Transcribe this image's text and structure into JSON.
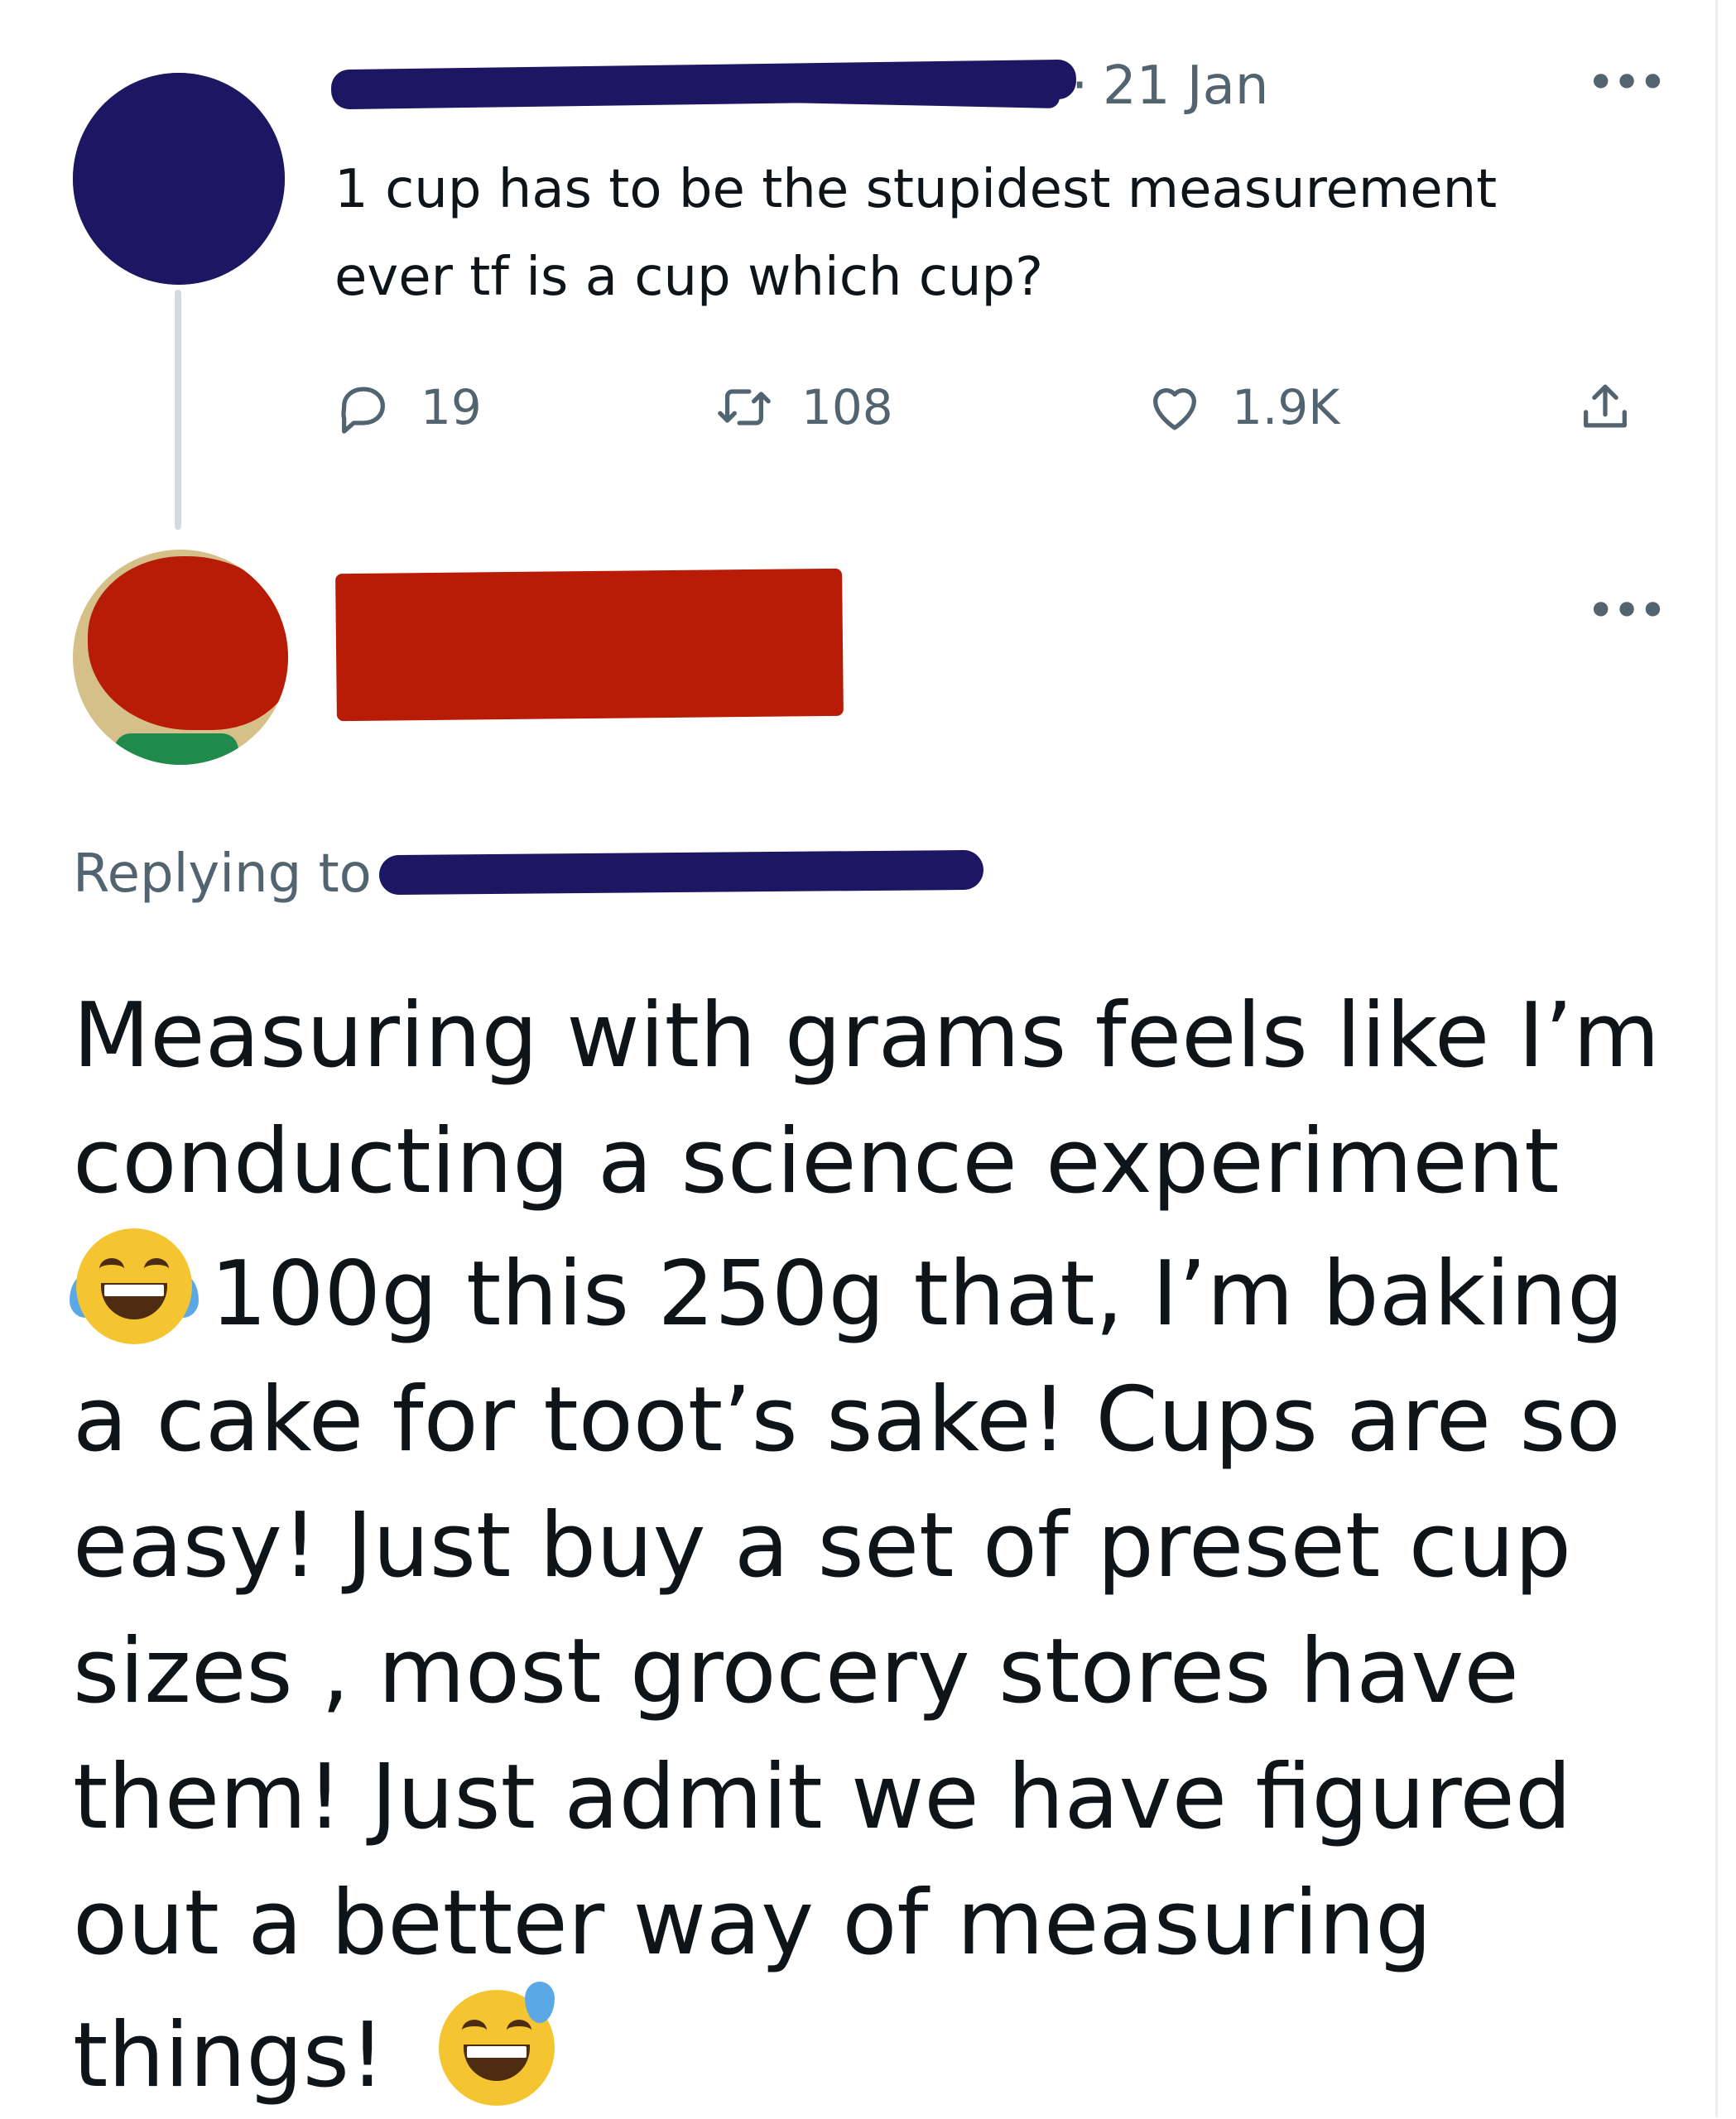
{
  "tweet1": {
    "date": "21 Jan",
    "text": "1 cup has to be the stupidest measurement ever tf is a cup which cup?",
    "stats": {
      "replies": "19",
      "retweets": "108",
      "likes": "1.9K"
    },
    "icons": [
      "reply-icon",
      "retweet-icon",
      "heart-icon",
      "share-icon",
      "more-icon"
    ]
  },
  "tweet2": {
    "replying_to": "Replying to",
    "text_parts": {
      "line_1": "Measuring with grams feels like I’m conducting a science experiment",
      "line_2": "100g this 250g that, I’m baking a cake for toot’s sake! Cups are so easy! Just buy a set of preset cup sizes , most grocery stores have them! Just admit we have figured out a better way of measuring things!"
    },
    "emojis": [
      "tears-of-joy-emoji",
      "grinning-sweat-emoji"
    ]
  },
  "colors": {
    "text": "#0f1419",
    "secondary": "#536471",
    "redaction_blue": "#1c1663",
    "redaction_red": "#b81c06"
  }
}
